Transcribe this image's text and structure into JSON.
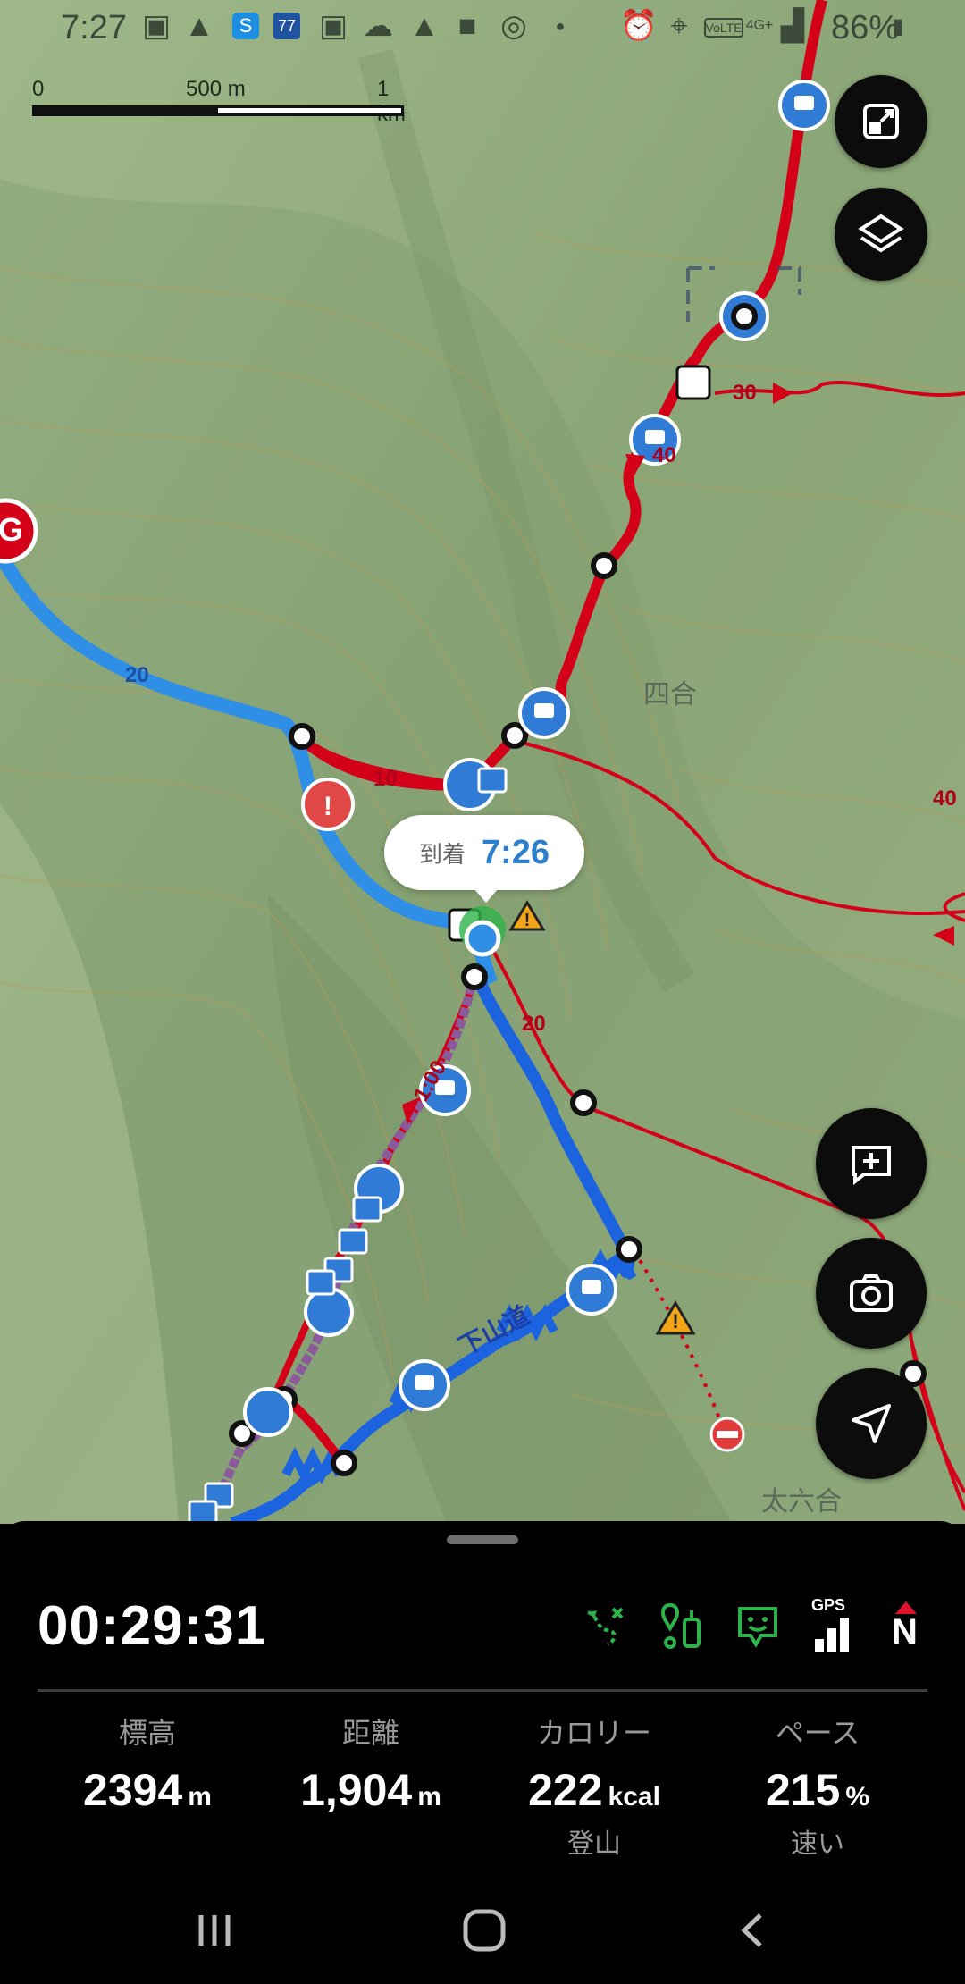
{
  "status_bar": {
    "time": "7:27",
    "battery": "86%",
    "network": "4G+"
  },
  "scale": {
    "zero": "0",
    "mid": "500 m",
    "end": "1 km"
  },
  "map": {
    "place_labels": [
      "四合",
      "太六合"
    ],
    "trail_label": "下山道",
    "trail_numbers": [
      "20",
      "10",
      "20",
      "30",
      "40",
      "40",
      "1:00"
    ],
    "arrival_callout": {
      "label": "到着",
      "time": "7:26"
    },
    "goal_marker": "G"
  },
  "panel": {
    "elapsed_time": "00:29:31",
    "gps_label": "GPS",
    "compass_label": "N",
    "stats": [
      {
        "label": "標高",
        "value": "2394",
        "unit": "m",
        "sub": ""
      },
      {
        "label": "距離",
        "value": "1,904",
        "unit": "m",
        "sub": ""
      },
      {
        "label": "カロリー",
        "value": "222",
        "unit": "kcal",
        "sub": "登山"
      },
      {
        "label": "ペース",
        "value": "215",
        "unit": "%",
        "sub": "速い"
      }
    ]
  },
  "colors": {
    "route_red": "#d4001a",
    "track_blue": "#2f8ee6",
    "accent_green": "#2db34a",
    "panel_bg": "#000000"
  }
}
